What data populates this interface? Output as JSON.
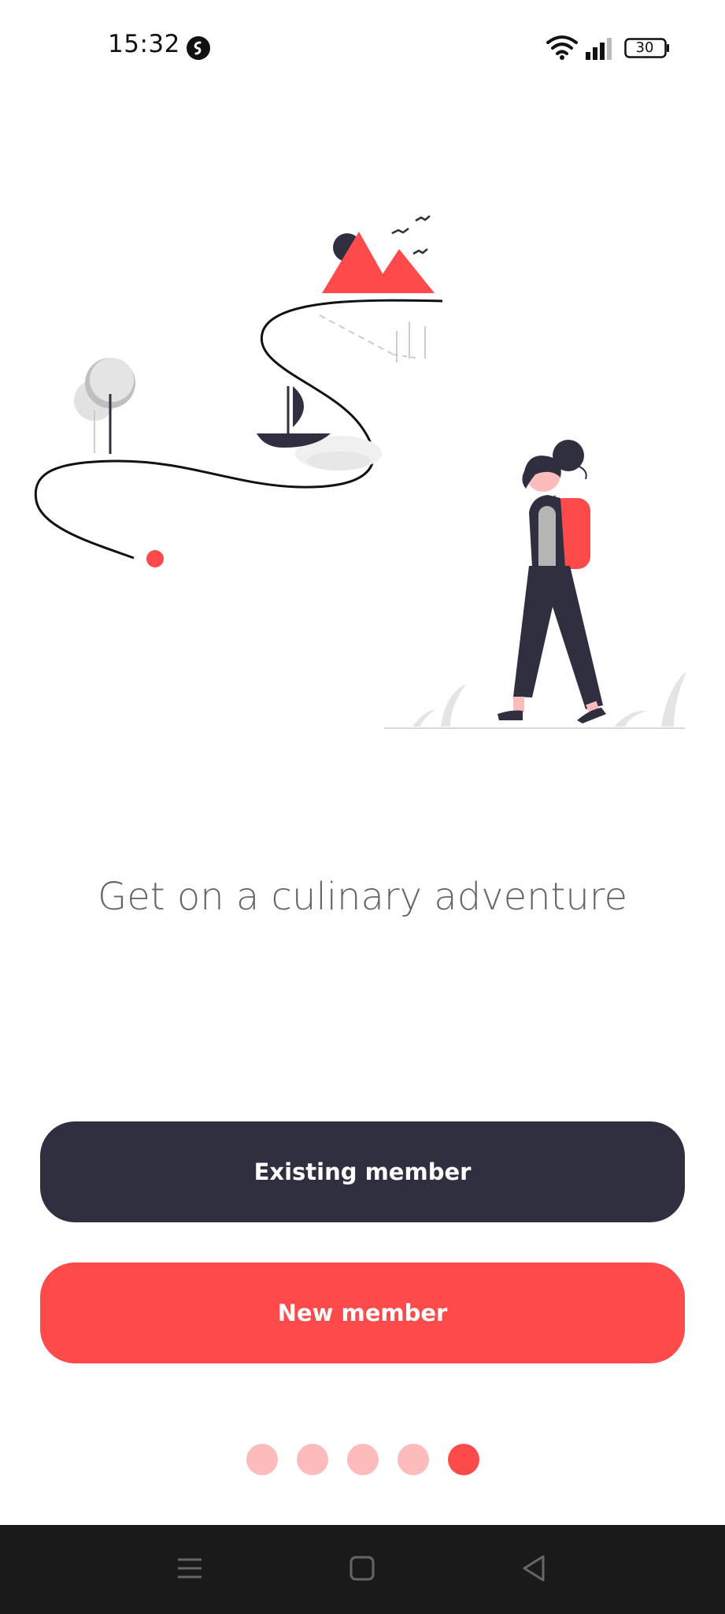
{
  "status_bar": {
    "time": "15:32",
    "battery": "30",
    "icons": [
      "shazam-icon",
      "wifi-icon",
      "cell-signal-icon",
      "battery-icon"
    ]
  },
  "headline": "Get on a culinary adventure",
  "buttons": {
    "existing_member": "Existing member",
    "new_member": "New member"
  },
  "pagination": {
    "total": 5,
    "active_index": 4
  },
  "nav_bar": {
    "icons": [
      "menu-icon",
      "home-square-icon",
      "back-triangle-icon"
    ]
  },
  "colors": {
    "accent_red": "#fe4a4b",
    "dark_navy": "#302f3f",
    "dot_inactive": "#fdbcbc",
    "headline_gray": "#666666",
    "nav_bar_bg": "#1a1a1a"
  }
}
